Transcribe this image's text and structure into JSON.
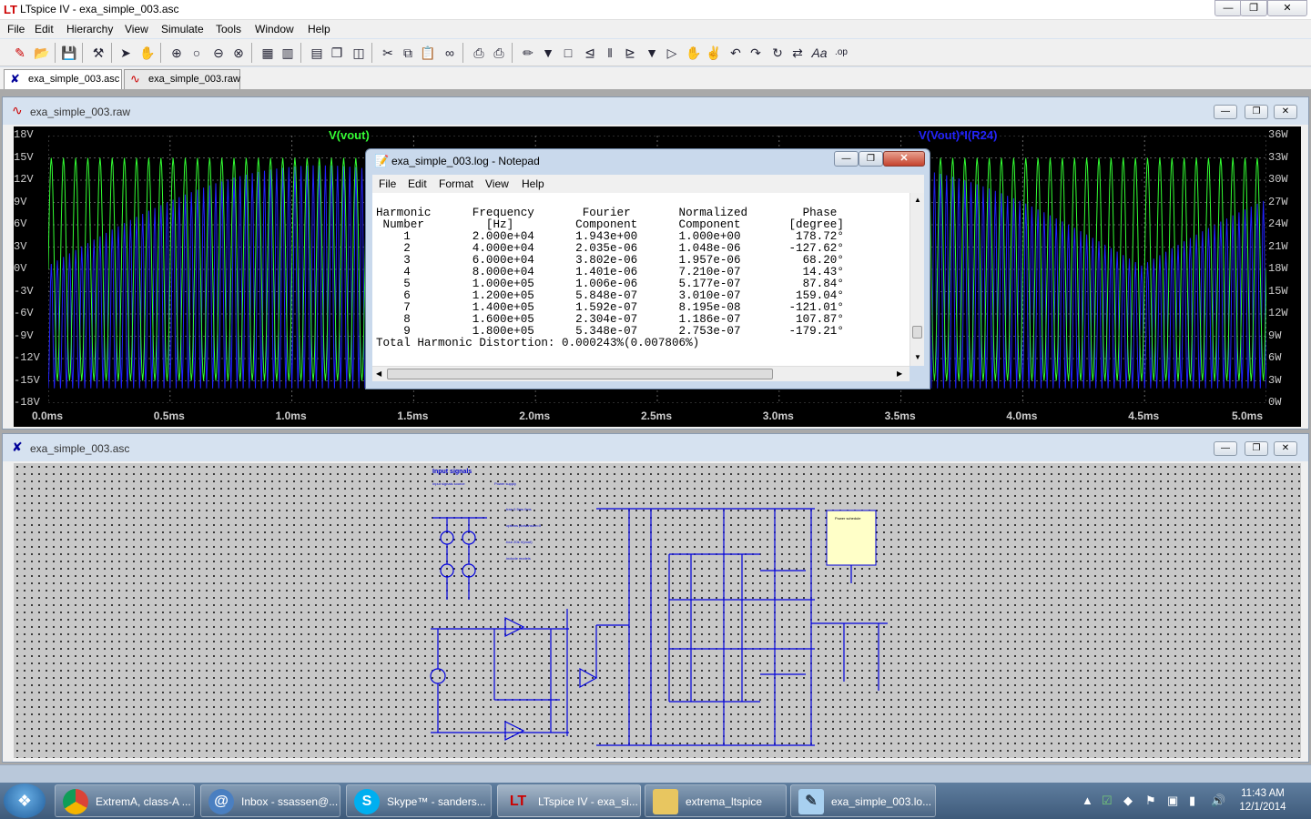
{
  "app": {
    "title": "LTspice IV - exa_simple_003.asc"
  },
  "menubar": [
    "File",
    "Edit",
    "Hierarchy",
    "View",
    "Simulate",
    "Tools",
    "Window",
    "Help"
  ],
  "tabs": [
    {
      "label": "exa_simple_003.asc",
      "icon": "schematic-icon"
    },
    {
      "label": "exa_simple_003.raw",
      "icon": "waveform-icon"
    }
  ],
  "waveform": {
    "title": "exa_simple_003.raw",
    "trace1_label": "V(vout)",
    "trace2_label": "V(Vout)*I(R24)",
    "trace1_color": "#33ff33",
    "trace2_color": "#2222ff",
    "y_left": [
      "18V",
      "15V",
      "12V",
      "9V",
      "6V",
      "3V",
      "0V",
      "-3V",
      "-6V",
      "-9V",
      "-12V",
      "-15V",
      "-18V"
    ],
    "y_right": [
      "36W",
      "33W",
      "30W",
      "27W",
      "24W",
      "21W",
      "18W",
      "15W",
      "12W",
      "9W",
      "6W",
      "3W",
      "0W"
    ],
    "x_ticks": [
      "0.0ms",
      "0.5ms",
      "1.0ms",
      "1.5ms",
      "2.0ms",
      "2.5ms",
      "3.0ms",
      "3.5ms",
      "4.0ms",
      "4.5ms",
      "5.0ms"
    ]
  },
  "notepad": {
    "title": "exa_simple_003.log - Notepad",
    "menu": [
      "File",
      "Edit",
      "Format",
      "View",
      "Help"
    ],
    "lines": [
      "Harmonic      Frequency       Fourier       Normalized        Phase",
      " Number         [Hz]         Component      Component       [degree]",
      "    1         2.000e+04      1.943e+00      1.000e+00        178.72°",
      "    2         4.000e+04      2.035e-06      1.048e-06       -127.62°",
      "    3         6.000e+04      3.802e-06      1.957e-06         68.20°",
      "    4         8.000e+04      1.401e-06      7.210e-07         14.43°",
      "    5         1.000e+05      1.006e-06      5.177e-07         87.84°",
      "    6         1.200e+05      5.848e-07      3.010e-07        159.04°",
      "    7         1.400e+05      1.592e-07      8.195e-08       -121.01°",
      "    8         1.600e+05      2.304e-07      1.186e-07        107.87°",
      "    9         1.800e+05      5.348e-07      2.753e-07       -179.21°",
      "Total Harmonic Distortion: 0.000243%(0.007806%)"
    ]
  },
  "schematic": {
    "title": "exa_simple_003.asc",
    "heading": "Input signals",
    "box_title": "Power schedule"
  },
  "taskbar": {
    "items": [
      {
        "label": "ExtremA, class-A ...",
        "icon": "chrome-icon"
      },
      {
        "label": "Inbox - ssassen@...",
        "icon": "mail-icon"
      },
      {
        "label": "Skype™ - sanders...",
        "icon": "skype-icon"
      },
      {
        "label": "LTspice IV - exa_si...",
        "icon": "ltspice-icon"
      },
      {
        "label": "extrema_ltspice",
        "icon": "folder-icon"
      },
      {
        "label": "exa_simple_003.lo...",
        "icon": "notepad-icon"
      }
    ],
    "time": "11:43 AM",
    "date": "12/1/2014"
  }
}
